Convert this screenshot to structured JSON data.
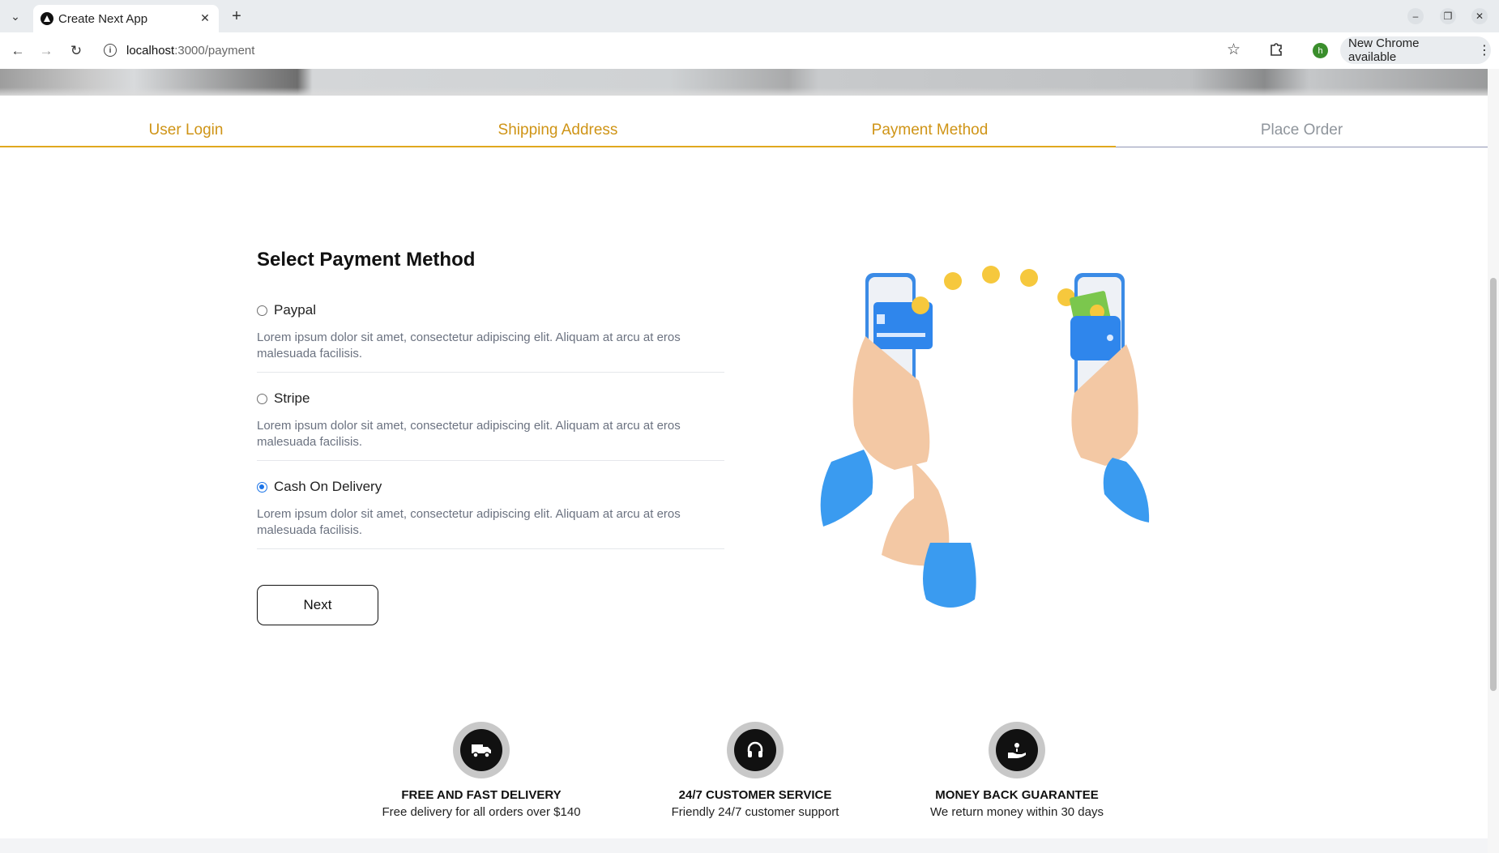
{
  "browser": {
    "tab_title": "Create Next App",
    "url_host": "localhost",
    "url_path": ":3000/payment",
    "profile_initial": "h",
    "update_label": "New Chrome available"
  },
  "steps": [
    {
      "label": "User Login",
      "state": "complete"
    },
    {
      "label": "Shipping Address",
      "state": "complete"
    },
    {
      "label": "Payment Method",
      "state": "complete"
    },
    {
      "label": "Place Order",
      "state": "inactive"
    }
  ],
  "payment": {
    "heading": "Select Payment Method",
    "options": [
      {
        "label": "Paypal",
        "desc": "Lorem ipsum dolor sit amet, consectetur adipiscing elit. Aliquam at arcu at eros malesuada facilisis.",
        "checked": false
      },
      {
        "label": "Stripe",
        "desc": "Lorem ipsum dolor sit amet, consectetur adipiscing elit. Aliquam at arcu at eros malesuada facilisis.",
        "checked": false
      },
      {
        "label": "Cash On Delivery",
        "desc": "Lorem ipsum dolor sit amet, consectetur adipiscing elit. Aliquam at arcu at eros malesuada facilisis.",
        "checked": true
      }
    ],
    "next_label": "Next"
  },
  "features": [
    {
      "icon": "delivery-truck-icon",
      "title": "FREE AND FAST DELIVERY",
      "desc": "Free delivery for all orders over $140"
    },
    {
      "icon": "headset-icon",
      "title": "24/7 CUSTOMER SERVICE",
      "desc": "Friendly 24/7 customer support"
    },
    {
      "icon": "money-hand-icon",
      "title": "MONEY BACK GUARANTEE",
      "desc": "We return money within 30 days"
    }
  ],
  "colors": {
    "accent": "#cf9416",
    "inactive_step": "#8f959c",
    "radio_checked": "#1a73e8"
  }
}
